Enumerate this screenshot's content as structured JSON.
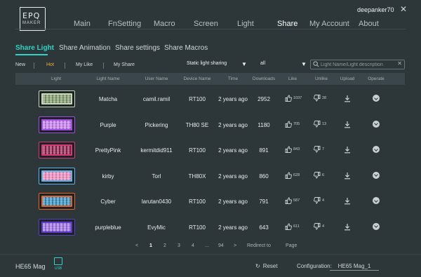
{
  "app": {
    "logo_line1": "EPQ",
    "logo_line2": "MAKER",
    "username": "deepanker70",
    "close_glyph": "✕"
  },
  "nav": {
    "items": [
      {
        "label": "Main"
      },
      {
        "label": "FnSetting"
      },
      {
        "label": "Macro"
      },
      {
        "label": "Screen"
      },
      {
        "label": "Light"
      },
      {
        "label": "Share",
        "active": true
      },
      {
        "label": "My Account"
      },
      {
        "label": "About"
      }
    ]
  },
  "subtabs": [
    {
      "label": "Share Light",
      "active": true
    },
    {
      "label": "Share Animation"
    },
    {
      "label": "Share settings"
    },
    {
      "label": "Share Macros"
    }
  ],
  "filters": {
    "new": "New",
    "hot": "Hot",
    "my_like": "My Like",
    "my_share": "My Share",
    "type_select": "Static light sharing",
    "scope_select": "all",
    "search_placeholder": "Light Name/Light description"
  },
  "table": {
    "headers": {
      "light": "Light",
      "light_name": "Light Name",
      "user_name": "User Name",
      "device_name": "Device Name",
      "time": "Time",
      "downloads": "Downloads",
      "like": "Like",
      "unlike": "Unlike",
      "upload": "Upload",
      "operate": "Operate"
    },
    "rows": [
      {
        "name": "Matcha",
        "user": "camil.ramil",
        "device": "RT100",
        "time": "2 years ago",
        "downloads": "2952",
        "likes": "1037",
        "unlikes": "28",
        "thumb_color": "#c9d8b8",
        "key_color": "#7e9a6a"
      },
      {
        "name": "Purple",
        "user": "Pickering",
        "device": "TH80 SE",
        "time": "2 years ago",
        "downloads": "1180",
        "likes": "705",
        "unlikes": "13",
        "thumb_color": "#a24be0",
        "key_color": "#c67cf2"
      },
      {
        "name": "PrettyPink",
        "user": "kermitdid911",
        "device": "RT100",
        "time": "2 years ago",
        "downloads": "891",
        "likes": "843",
        "unlikes": "7",
        "thumb_color": "#d43a78",
        "key_color": "#8e1c4a"
      },
      {
        "name": "kirby",
        "user": "Torl",
        "device": "TH80X",
        "time": "2 years ago",
        "downloads": "860",
        "likes": "628",
        "unlikes": "6",
        "thumb_color": "#5db6ea",
        "key_color": "#f28bc0"
      },
      {
        "name": "Cyber",
        "user": "larutan0430",
        "device": "RT100",
        "time": "2 years ago",
        "downloads": "791",
        "likes": "587",
        "unlikes": "4",
        "thumb_color": "#e2632e",
        "key_color": "#2f8fc2"
      },
      {
        "name": "purpleblue",
        "user": "EvyMic",
        "device": "RT100",
        "time": "2 years ago",
        "downloads": "643",
        "likes": "611",
        "unlikes": "4",
        "thumb_color": "#5a3ec8",
        "key_color": "#9c6de6"
      }
    ]
  },
  "pagination": {
    "prev": "<",
    "pages": [
      "1",
      "2",
      "3",
      "4",
      "...",
      "94"
    ],
    "next": ">",
    "redirect_label": "Redirect to",
    "page_label": "Page"
  },
  "footer": {
    "device": "HE65 Mag",
    "usb_label": "USB",
    "reset_label": "Reset",
    "config_label": "Configuration:",
    "config_value": "HE65 Mag_1"
  },
  "colors": {
    "accent": "#2fd3c7",
    "hot": "#f0b43a",
    "background": "#2d3739"
  }
}
